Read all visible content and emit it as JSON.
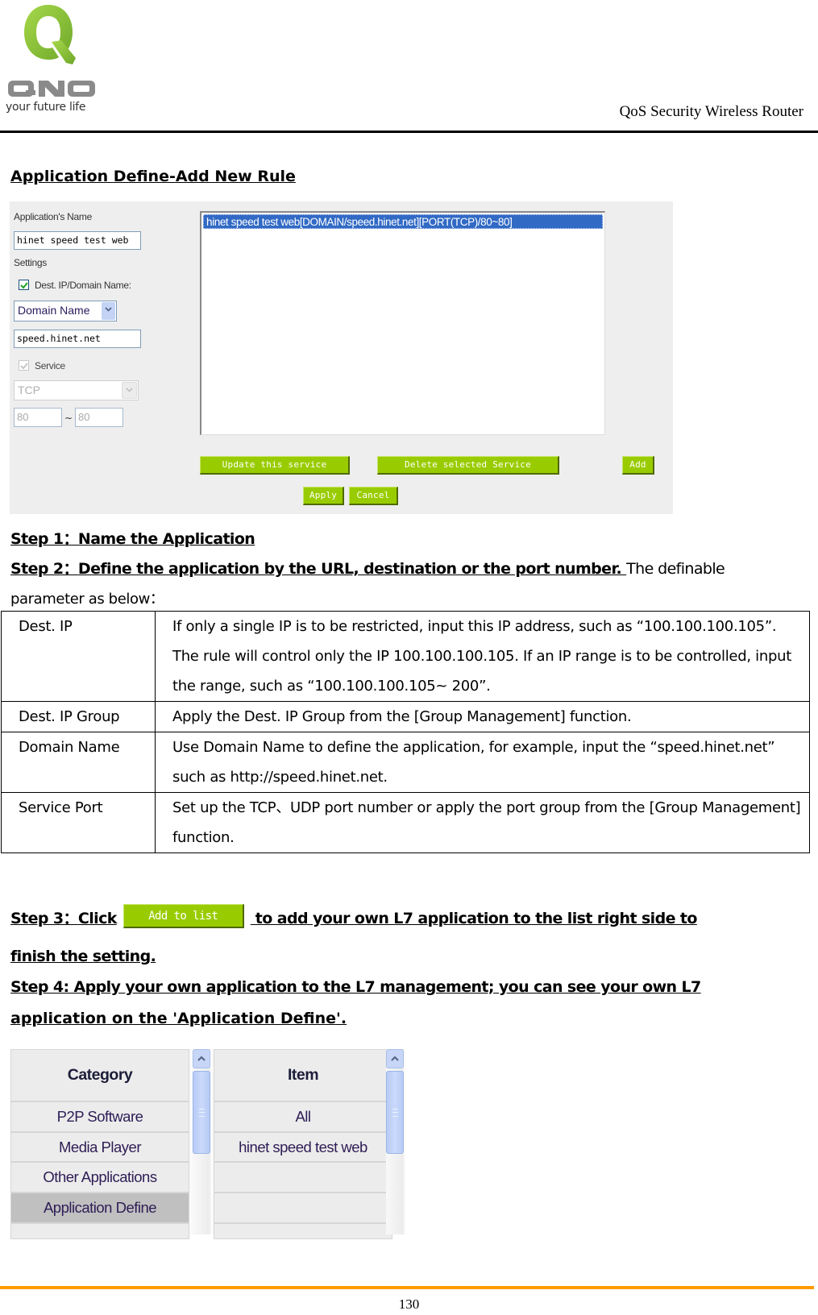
{
  "header": {
    "logo_text": "QNO",
    "logo_tagline": "your future life",
    "title": "QoS Security Wireless Router",
    "brand_colors": {
      "logo_green": "#8cc63f",
      "logo_gray": "#8a8a8a"
    }
  },
  "section_title": "Application Define-Add New Rule",
  "add_rule_form": {
    "app_name_label": "Application's Name",
    "app_name_value": "hinet speed test web",
    "settings_label": "Settings",
    "dest_checkbox_label": "Dest. IP/Domain Name:",
    "dest_checked": true,
    "dest_type_selected": "Domain Name",
    "domain_value": "speed.hinet.net",
    "service_checkbox_label": "Service",
    "service_checked": true,
    "service_disabled": true,
    "protocol_selected": "TCP",
    "port_from": "80",
    "port_separator": "~",
    "port_to": "80",
    "service_list": [
      "hinet speed test web[DOMAIN/speed.hinet.net][PORT(TCP)/80~80]"
    ],
    "buttons": {
      "update": "Update this service",
      "delete": "Delete selected Service",
      "add": "Add",
      "apply": "Apply",
      "cancel": "Cancel"
    },
    "button_color": "#99cc00",
    "selection_color": "#316ac5"
  },
  "steps": {
    "step1_label": "Step 1",
    "step1_sep": "：",
    "step1_text": "Name the Application",
    "step2_label": "Step 2",
    "step2_sep": "：",
    "step2_text": "Define the application by the URL, destination or the port number. ",
    "step2_tail": "The definable",
    "step2_line2": "parameter as below：",
    "step3_label": "Step 3",
    "step3_sep": "：",
    "step3_click": "Click",
    "step3_button": "Add to list",
    "step3_text": " to add your own L7 application to the list right side to ",
    "step3_line2": "finish the setting.",
    "step4_line1": "Step 4: Apply your own application to the L7 management; you can see your own L7 ",
    "step4_line2": "application on the 'Application Define'."
  },
  "parameter_table": [
    {
      "name": "Dest. IP",
      "description": "If only a single IP is to be restricted, input this IP address, such as “100.100.100.105”. The rule will control only the IP 100.100.100.105. If an IP range is to be controlled, input the range, such as “100.100.100.105~ 200”."
    },
    {
      "name": "Dest. IP Group",
      "description": "Apply the Dest. IP Group from the [Group Management] function."
    },
    {
      "name": "Domain Name",
      "description": "Use Domain Name to define the application, for example, input the “speed.hinet.net” such as http://speed.hinet.net."
    },
    {
      "name": "Service Port",
      "description": "Set up the TCP、UDP port number or apply the port group from the [Group Management] function."
    }
  ],
  "app_define_view": {
    "category_header": "Category",
    "categories": [
      "P2P Software",
      "Media Player",
      "Other Applications",
      "Application Define",
      ""
    ],
    "selected_category": "Application Define",
    "item_header": "Item",
    "items": [
      "All",
      "hinet speed test web",
      "",
      "",
      ""
    ]
  },
  "footer": {
    "page_number": "130",
    "rule_color": "#ff9900"
  }
}
